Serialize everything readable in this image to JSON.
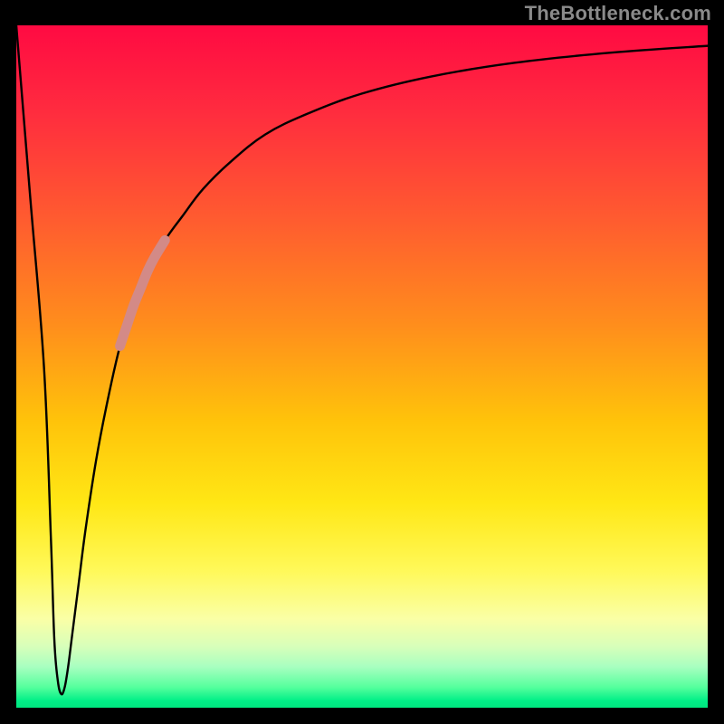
{
  "watermark": "TheBottleneck.com",
  "chart_data": {
    "type": "line",
    "title": "",
    "xlabel": "",
    "ylabel": "",
    "xlim": [
      0,
      100
    ],
    "ylim": [
      0,
      100
    ],
    "grid": false,
    "series": [
      {
        "name": "bottleneck-curve",
        "color": "#000000",
        "x": [
          0,
          2,
          4,
          5,
          5.5,
          6,
          6.5,
          7,
          7.5,
          8,
          9,
          10,
          11.5,
          13,
          15,
          17,
          19,
          21.5,
          24,
          27,
          31,
          36,
          42,
          50,
          60,
          72,
          86,
          100
        ],
        "y": [
          100,
          75,
          50,
          25,
          10,
          4,
          2,
          3,
          6,
          10,
          18,
          26,
          36,
          44,
          53,
          59,
          64,
          68.5,
          72,
          76,
          80,
          84,
          87,
          90,
          92.5,
          94.5,
          96,
          97
        ]
      }
    ],
    "highlight": {
      "name": "highlight-segment",
      "color": "#d38a87",
      "x": [
        15,
        16,
        17,
        18,
        19,
        20,
        21.5
      ],
      "y": [
        53,
        56,
        59,
        61.5,
        64,
        66,
        68.5
      ]
    },
    "gradient_stops": [
      {
        "pos": 0.0,
        "color": "#ff0a42"
      },
      {
        "pos": 0.28,
        "color": "#ff5a30"
      },
      {
        "pos": 0.58,
        "color": "#ffc30a"
      },
      {
        "pos": 0.8,
        "color": "#fff95a"
      },
      {
        "pos": 0.94,
        "color": "#a8ffc0"
      },
      {
        "pos": 1.0,
        "color": "#00e67f"
      }
    ]
  }
}
